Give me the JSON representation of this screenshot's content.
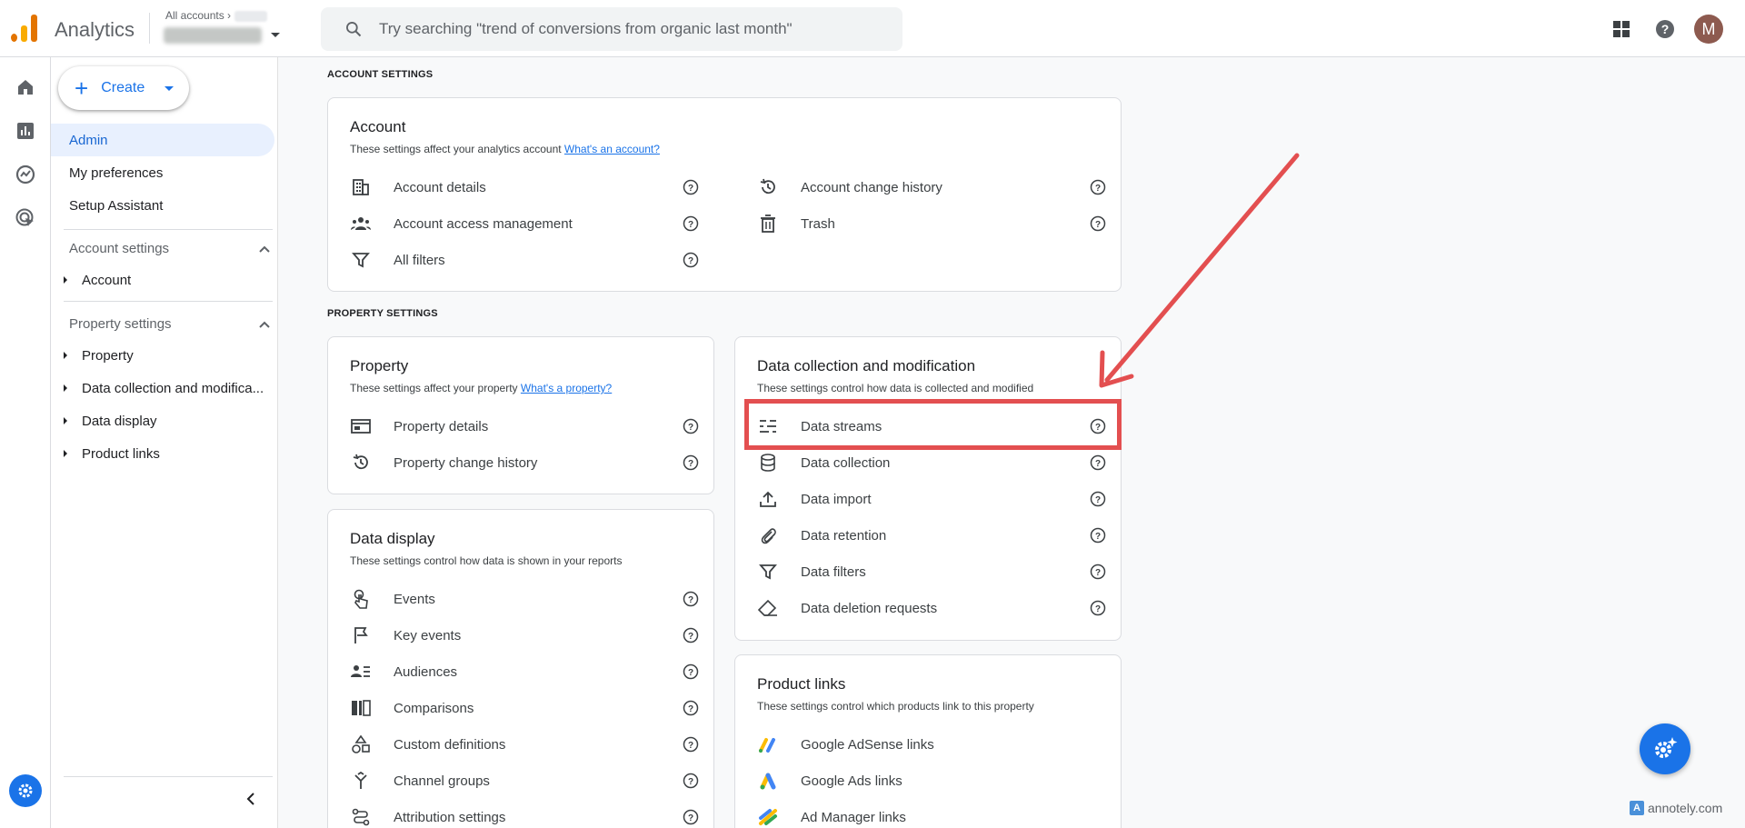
{
  "app": {
    "title": "Analytics"
  },
  "header": {
    "breadcrumb": "All accounts",
    "search_placeholder": "Try searching \"trend of conversions from organic last month\"",
    "avatar_initial": "M"
  },
  "nav": {
    "create_label": "Create",
    "items": [
      {
        "label": "Admin"
      },
      {
        "label": "My preferences"
      },
      {
        "label": "Setup Assistant"
      }
    ],
    "account_settings": {
      "title": "Account settings",
      "children": [
        "Account"
      ]
    },
    "property_settings": {
      "title": "Property settings",
      "children": [
        "Property",
        "Data collection and modifica...",
        "Data display",
        "Product links"
      ]
    }
  },
  "main": {
    "account_section_label": "ACCOUNT SETTINGS",
    "property_section_label": "PROPERTY SETTINGS",
    "account_card": {
      "title": "Account",
      "desc": "These settings affect your analytics account",
      "link": "What's an account?",
      "left": [
        "Account details",
        "Account access management",
        "All filters"
      ],
      "right": [
        "Account change history",
        "Trash"
      ]
    },
    "property_card": {
      "title": "Property",
      "desc": "These settings affect your property",
      "link": "What's a property?",
      "rows": [
        "Property details",
        "Property change history"
      ]
    },
    "data_display_card": {
      "title": "Data display",
      "desc": "These settings control how data is shown in your reports",
      "rows": [
        "Events",
        "Key events",
        "Audiences",
        "Comparisons",
        "Custom definitions",
        "Channel groups",
        "Attribution settings"
      ]
    },
    "data_collection_card": {
      "title": "Data collection and modification",
      "desc": "These settings control how data is collected and modified",
      "rows": [
        "Data streams",
        "Data collection",
        "Data import",
        "Data retention",
        "Data filters",
        "Data deletion requests"
      ]
    },
    "product_links_card": {
      "title": "Product links",
      "desc": "These settings control which products link to this property",
      "rows": [
        "Google AdSense links",
        "Google Ads links",
        "Ad Manager links"
      ]
    }
  },
  "watermark": "annotely.com",
  "colors": {
    "accent": "#1a73e8",
    "highlight": "#e34f50",
    "active_bg": "#e8f0fe"
  }
}
